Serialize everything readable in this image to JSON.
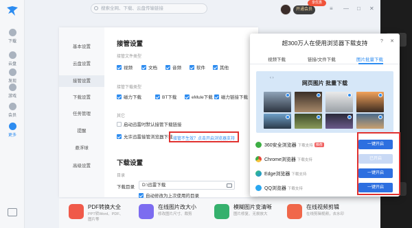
{
  "app": {
    "search_placeholder": "搜索全网、下载、云盘传输链接",
    "vip_button": "开通会员",
    "vip_tag": "享优惠"
  },
  "nav": {
    "items": [
      {
        "label": "下载",
        "icon": "download-icon"
      },
      {
        "label": "云盘",
        "icon": "cloud-icon"
      },
      {
        "label": "发现",
        "icon": "discover-icon"
      },
      {
        "label": "游戏",
        "icon": "game-icon"
      },
      {
        "label": "会员",
        "icon": "diamond-icon"
      },
      {
        "label": "更多",
        "icon": "more-icon"
      }
    ]
  },
  "settings": {
    "sidebar": [
      "基本设置",
      "云盘设置",
      "接管设置",
      "下载设置",
      "任务管理",
      "提醒",
      "悬浮球",
      "高级设置"
    ],
    "takeover_title": "接管设置",
    "file_type_label": "接管文件类型",
    "file_types": [
      "视频",
      "文档",
      "音频",
      "软件",
      "其他"
    ],
    "link_type_label": "接管下载类型",
    "link_types": [
      "磁力下载",
      "BT下载",
      "eMule下载",
      "磁力链接下载"
    ],
    "other_label": "其它",
    "other_opts": [
      "启动迅雷时默认接管下载链接",
      "允许迅雷接管浏览器下载"
    ],
    "hint_link": "接管不生效？点击开启浏览器支持",
    "download_title": "下载设置",
    "dir_section": "目录",
    "dir_label": "下载目录",
    "dir_value": "D:\\迅雷下载",
    "dir_checkbox": "自动修改为上次使用的目录"
  },
  "tools": [
    {
      "name": "PDF转换大全",
      "desc": "PPT转Word、PDF、",
      "desc2": "图片等",
      "color": "#f05a4a"
    },
    {
      "name": "在线图片改大小",
      "desc": "修改图片尺寸、裁剪",
      "desc2": "",
      "color": "#7c6cf0"
    },
    {
      "name": "模糊图片变清晰",
      "desc": "图片修复、无损放大",
      "desc2": "",
      "color": "#35b06d"
    },
    {
      "name": "在线视频剪辑",
      "desc": "在线剪辑视频，去水印",
      "desc2": "",
      "color": "#f0674a"
    }
  ],
  "popup": {
    "title": "超300万人在使用浏览器下载支持",
    "tabs": [
      "视频下载",
      "链接/文件下载",
      "图片批量下载"
    ],
    "preview_title": "网页图片 批量下载",
    "browsers": [
      {
        "name": "360安全浏览器",
        "sub": "下载支持",
        "tag": "推荐",
        "button": "一键开启",
        "color": "#3dae44"
      },
      {
        "name": "Chrome浏览器",
        "sub": "下载支持",
        "tag": "",
        "button": "已开启",
        "color": "#e6463b"
      },
      {
        "name": "Edge浏览器",
        "sub": "下载支持",
        "tag": "",
        "button": "一键开启",
        "color": "#1f8ee0"
      },
      {
        "name": "QQ浏览器",
        "sub": "下载支持",
        "tag": "",
        "button": "一键开启",
        "color": "#2aa7f0"
      }
    ]
  }
}
